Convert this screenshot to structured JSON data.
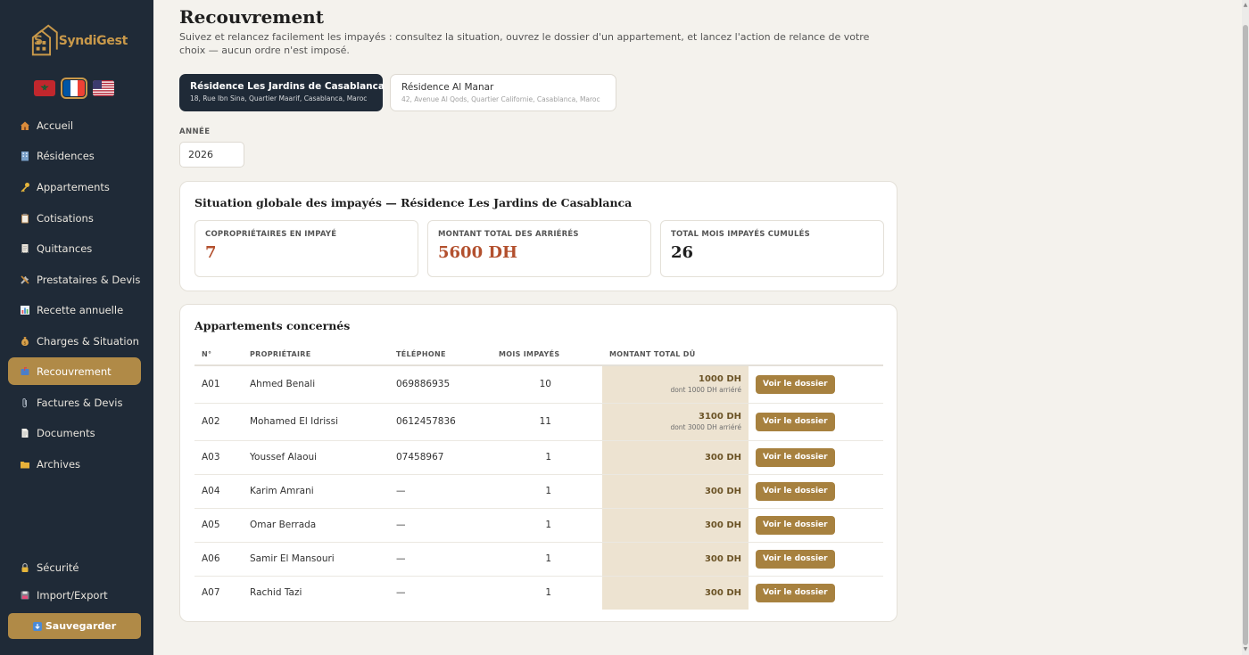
{
  "app": {
    "name": "SyndiGest",
    "brand_color": "#c9994a",
    "sidebar_bg": "#1f2a37"
  },
  "languages": [
    {
      "code": "ma",
      "icon": "morocco-flag-icon"
    },
    {
      "code": "fr",
      "icon": "france-flag-icon",
      "selected": true
    },
    {
      "code": "us",
      "icon": "usa-flag-icon"
    }
  ],
  "sidebar": {
    "items": [
      {
        "label": "Accueil",
        "icon": "house-icon"
      },
      {
        "label": "Résidences",
        "icon": "building-icon"
      },
      {
        "label": "Appartements",
        "icon": "key-icon"
      },
      {
        "label": "Cotisations",
        "icon": "clipboard-icon"
      },
      {
        "label": "Quittances",
        "icon": "receipt-icon"
      },
      {
        "label": "Prestataires & Devis",
        "icon": "tools-icon"
      },
      {
        "label": "Recette annuelle",
        "icon": "bar-chart-icon"
      },
      {
        "label": "Charges & Situation",
        "icon": "money-bag-icon"
      },
      {
        "label": "Recouvrement",
        "icon": "mailbox-icon",
        "active": true
      },
      {
        "label": "Factures & Devis",
        "icon": "paperclip-icon"
      },
      {
        "label": "Documents",
        "icon": "document-icon"
      },
      {
        "label": "Archives",
        "icon": "folder-icon"
      }
    ],
    "bottom_items": [
      {
        "label": "Sécurité",
        "icon": "lock-icon"
      },
      {
        "label": "Import/Export",
        "icon": "floppy-disk-icon"
      }
    ],
    "save_label": "Sauvegarder",
    "save_icon": "download-icon"
  },
  "page": {
    "title": "Recouvrement",
    "description": "Suivez et relancez facilement les impayés : consultez la situation, ouvrez le dossier d'un appartement, et lancez l'action de relance de votre choix — aucun ordre n'est imposé."
  },
  "residences": [
    {
      "name": "Résidence Les Jardins de Casablanca",
      "address": "18, Rue Ibn Sina, Quartier Maarif, Casablanca, Maroc",
      "selected": true
    },
    {
      "name": "Résidence Al Manar",
      "address": "42, Avenue Al Qods, Quartier Californie, Casablanca, Maroc",
      "selected": false
    }
  ],
  "year": {
    "label": "ANNÉE",
    "value": "2026"
  },
  "summary": {
    "title": "Situation globale des impayés — Résidence Les Jardins de Casablanca",
    "stats": [
      {
        "label": "COPROPRIÉTAIRES EN IMPAYÉ",
        "value": "7",
        "color": "#b3502e"
      },
      {
        "label": "MONTANT TOTAL DES ARRIÉRÉS",
        "value": "5600 DH",
        "color": "#b3502e"
      },
      {
        "label": "TOTAL MOIS IMPAYÉS CUMULÉS",
        "value": "26",
        "color": "#1e1e1e"
      }
    ]
  },
  "apartments": {
    "title": "Appartements concernés",
    "columns": [
      "N°",
      "PROPRIÉTAIRE",
      "TÉLÉPHONE",
      "MOIS IMPAYÉS",
      "MONTANT TOTAL DÛ"
    ],
    "action_label": "Voir le dossier",
    "highlight_color": "#ede3d1",
    "rows": [
      {
        "num": "A01",
        "owner": "Ahmed Benali",
        "phone": "069886935",
        "months": "10",
        "amount": "1000 DH",
        "arrears": "dont 1000 DH arriéré"
      },
      {
        "num": "A02",
        "owner": "Mohamed El Idrissi",
        "phone": "0612457836",
        "months": "11",
        "amount": "3100 DH",
        "arrears": "dont 3000 DH arriéré"
      },
      {
        "num": "A03",
        "owner": "Youssef Alaoui",
        "phone": "07458967",
        "months": "1",
        "amount": "300 DH",
        "arrears": ""
      },
      {
        "num": "A04",
        "owner": "Karim Amrani",
        "phone": "—",
        "months": "1",
        "amount": "300 DH",
        "arrears": ""
      },
      {
        "num": "A05",
        "owner": "Omar Berrada",
        "phone": "—",
        "months": "1",
        "amount": "300 DH",
        "arrears": ""
      },
      {
        "num": "A06",
        "owner": "Samir El Mansouri",
        "phone": "—",
        "months": "1",
        "amount": "300 DH",
        "arrears": ""
      },
      {
        "num": "A07",
        "owner": "Rachid Tazi",
        "phone": "—",
        "months": "1",
        "amount": "300 DH",
        "arrears": ""
      }
    ]
  }
}
